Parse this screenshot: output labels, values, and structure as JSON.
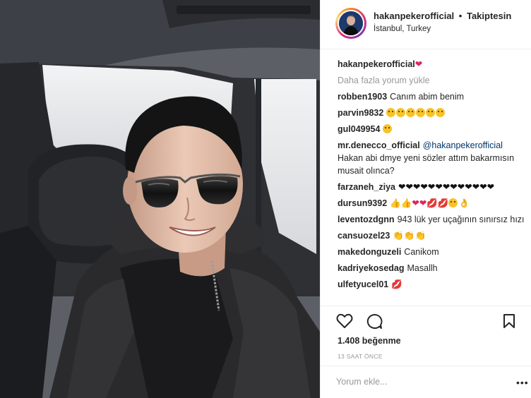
{
  "header": {
    "username": "hakanpekerofficial",
    "separator": "•",
    "follow_label": "Takiptesin",
    "location": "İstanbul, Turkey"
  },
  "caption": {
    "username": "hakanpekerofficial",
    "emoji": "❤"
  },
  "load_more_label": "Daha fazla yorum yükle",
  "comments": [
    {
      "user": "robben1903",
      "text": "Canım abim benim"
    },
    {
      "user": "parvin9832",
      "text": ""
    },
    {
      "user": "gul049954",
      "text": ""
    },
    {
      "user": "mr.denecco_official",
      "mention": "@hakanpekerofficial",
      "text": "Hakan abi dmye yeni sözler attım bakarmısın musait olınca?"
    },
    {
      "user": "farzaneh_ziya",
      "text": "❤❤❤❤❤❤❤❤❤❤❤❤❤"
    },
    {
      "user": "dursun9392",
      "text": ""
    },
    {
      "user": "leventozdgnn",
      "text": "943 lük yer uçağının sınırsız hızı"
    },
    {
      "user": "cansuozel23",
      "text": ""
    },
    {
      "user": "makedonguzeli",
      "text": "Canikom"
    },
    {
      "user": "kadriyekosedag",
      "text": "Masallh"
    },
    {
      "user": "ulfetyucel01",
      "text": ""
    }
  ],
  "icons": {
    "like": "heart-outline-icon",
    "comment": "speech-bubble-icon",
    "save": "bookmark-icon",
    "more": "ellipsis-icon"
  },
  "likes_label": "1.408 beğenme",
  "timestamp": "13 SAAT ÖNCE",
  "add_comment_placeholder": "Yorum ekle...",
  "more_label": "•••"
}
